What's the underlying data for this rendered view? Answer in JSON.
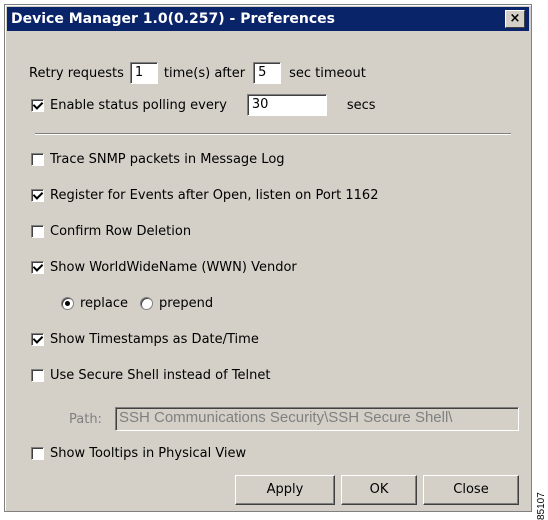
{
  "window": {
    "title": "Device Manager 1.0(0.257) - Preferences",
    "close_glyph": "×"
  },
  "retry": {
    "prefix": "Retry requests",
    "count": "1",
    "middle": "time(s) after",
    "timeout": "5",
    "suffix": "sec timeout"
  },
  "polling": {
    "label": "Enable status polling every",
    "checked": true,
    "value": "30",
    "suffix": "secs"
  },
  "options": {
    "trace_snmp": {
      "label": "Trace SNMP packets in Message Log",
      "checked": false
    },
    "register_events": {
      "label": "Register for Events after Open, listen on Port 1162",
      "checked": true
    },
    "confirm_delete": {
      "label": "Confirm Row Deletion",
      "checked": false
    },
    "show_wwn": {
      "label": "Show WorldWideName (WWN) Vendor",
      "checked": true
    },
    "timestamps": {
      "label": "Show Timestamps as Date/Time",
      "checked": true
    },
    "secure_shell": {
      "label": "Use Secure Shell instead of Telnet",
      "checked": false
    },
    "tooltips": {
      "label": "Show Tooltips in Physical View",
      "checked": false
    }
  },
  "wwn_mode": {
    "replace": "replace",
    "prepend": "prepend",
    "selected": "replace"
  },
  "path": {
    "label": "Path:",
    "value": "SSH Communications Security\\SSH Secure Shell\\"
  },
  "buttons": {
    "apply": "Apply",
    "ok": "OK",
    "close": "Close"
  },
  "side_mark": "85107"
}
